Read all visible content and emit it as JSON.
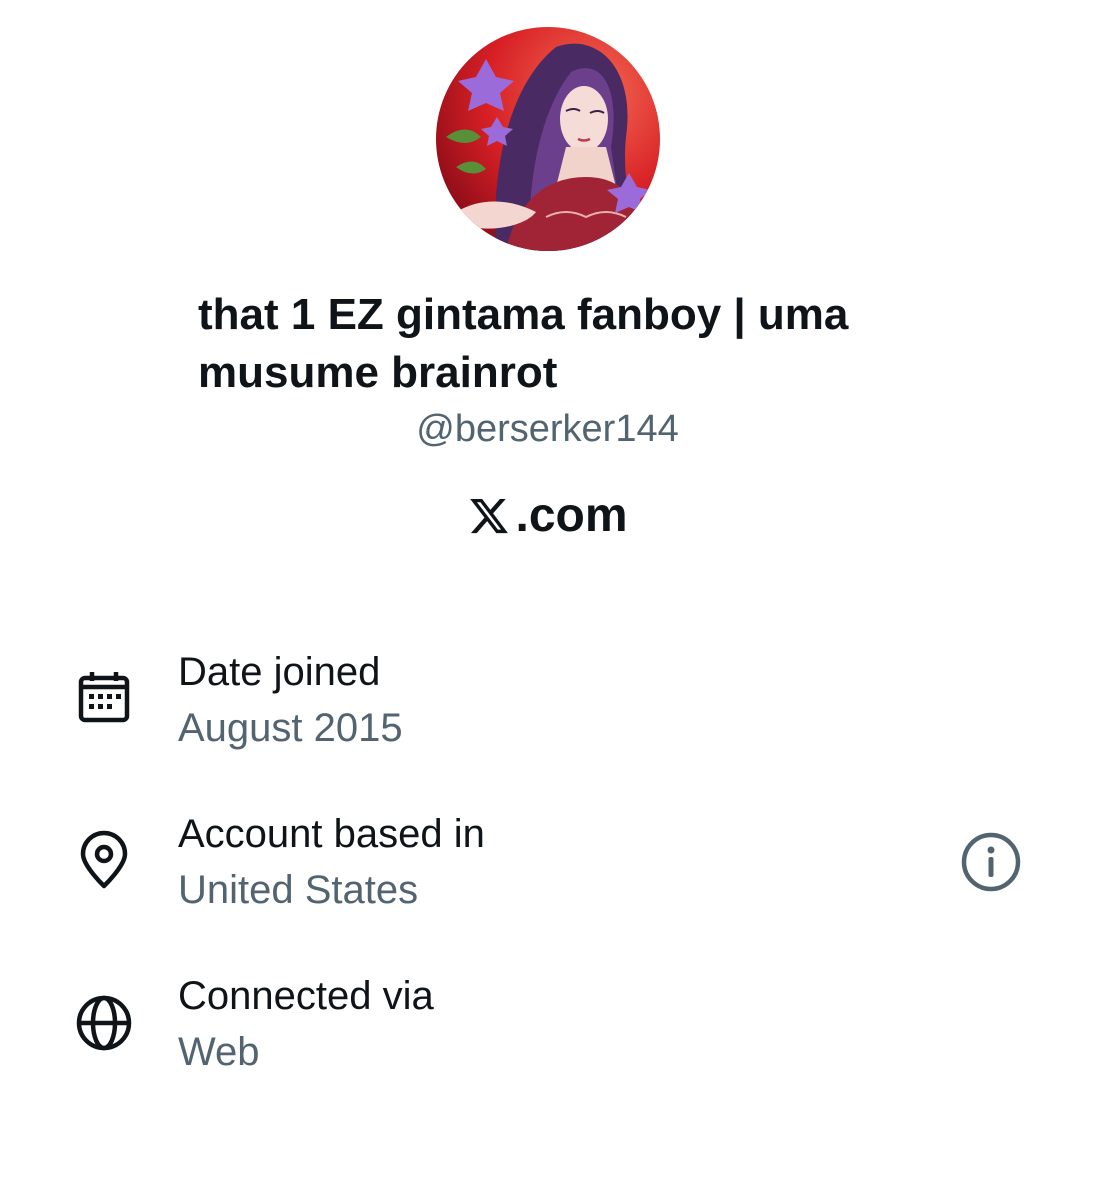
{
  "profile": {
    "display_name": "that 1 EZ gintama fanboy | uma musume brainrot",
    "handle": "@berserker144",
    "avatar_icon": "profile-avatar-anime-character"
  },
  "site": {
    "logo_text": ".com",
    "logo_icon": "x-logo-icon"
  },
  "details": [
    {
      "label": "Date joined",
      "value": "August 2015",
      "icon": "calendar-icon"
    },
    {
      "label": "Account based in",
      "value": "United States",
      "icon": "location-pin-icon"
    },
    {
      "label": "Connected via",
      "value": "Web",
      "icon": "globe-icon"
    }
  ],
  "colors": {
    "text_primary": "#0f1419",
    "text_secondary": "#536471"
  }
}
